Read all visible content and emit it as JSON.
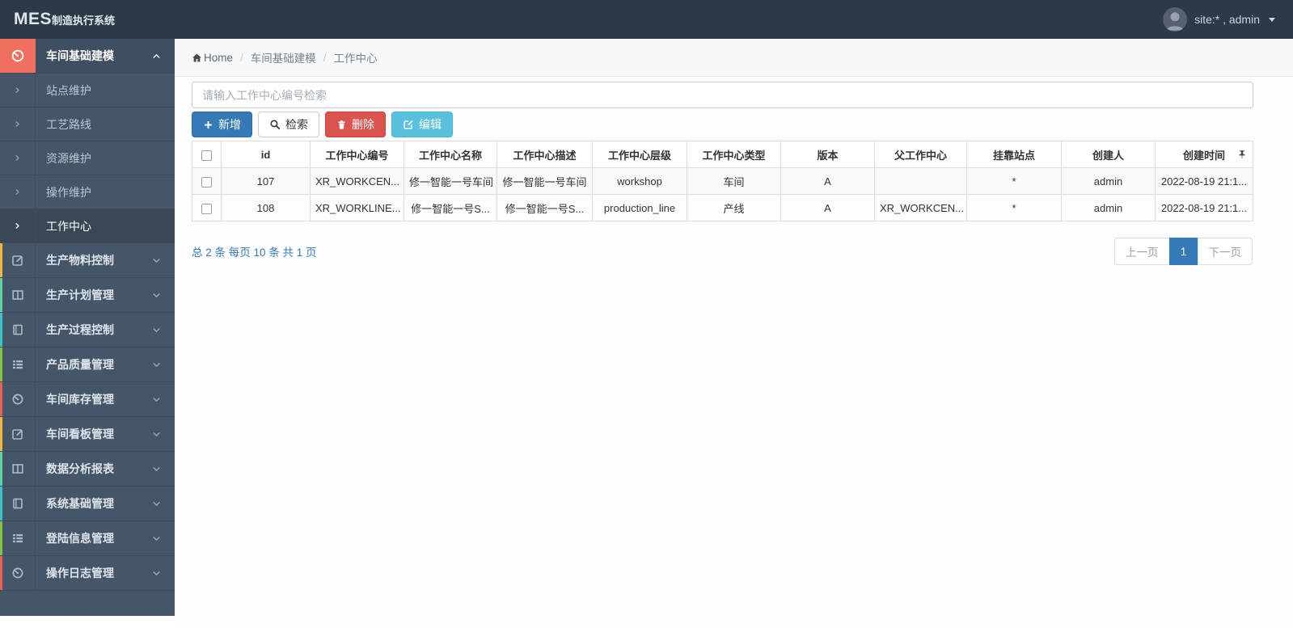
{
  "topbar": {
    "logo_main": "MES",
    "logo_sub": "制造执行系统",
    "user_label": "site:* , admin"
  },
  "breadcrumb": {
    "home": "Home",
    "section": "车间基础建模",
    "page": "工作中心"
  },
  "sidebar": {
    "active_parent": {
      "label": "车间基础建模",
      "icon": "gauge-icon",
      "icon_bg": "#ef705f"
    },
    "submenu": [
      {
        "label": "站点维护"
      },
      {
        "label": "工艺路线"
      },
      {
        "label": "资源维护"
      },
      {
        "label": "操作维护"
      },
      {
        "label": "工作中心"
      }
    ],
    "items": [
      {
        "label": "生产物料控制",
        "icon": "edit-icon",
        "strip_color": "#f5b63f"
      },
      {
        "label": "生产计划管理",
        "icon": "columns-icon",
        "strip_color": "#62d2a2"
      },
      {
        "label": "生产过程控制",
        "icon": "book-icon",
        "strip_color": "#3bc4c7"
      },
      {
        "label": "产品质量管理",
        "icon": "list-icon",
        "strip_color": "#85c440"
      },
      {
        "label": "车间库存管理",
        "icon": "gauge-icon",
        "strip_color": "#ea6153"
      },
      {
        "label": "车间看板管理",
        "icon": "edit-icon",
        "strip_color": "#f5b63f"
      },
      {
        "label": "数据分析报表",
        "icon": "columns-icon",
        "strip_color": "#62d2a2"
      },
      {
        "label": "系统基础管理",
        "icon": "book-icon",
        "strip_color": "#3bc4c7"
      },
      {
        "label": "登陆信息管理",
        "icon": "list-icon",
        "strip_color": "#85c440"
      },
      {
        "label": "操作日志管理",
        "icon": "gauge-icon",
        "strip_color": "#ea6153"
      }
    ]
  },
  "toolbar": {
    "search_placeholder": "请输入工作中心编号检索",
    "add_label": "新增",
    "search_label": "检索",
    "delete_label": "删除",
    "edit_label": "编辑"
  },
  "table": {
    "columns": [
      "id",
      "工作中心编号",
      "工作中心名称",
      "工作中心描述",
      "工作中心层级",
      "工作中心类型",
      "版本",
      "父工作中心",
      "挂靠站点",
      "创建人",
      "创建时间"
    ],
    "rows": [
      [
        "107",
        "XR_WORKCEN...",
        "修一智能一号车间",
        "修一智能一号车间",
        "workshop",
        "车间",
        "A",
        "",
        "*",
        "admin",
        "2022-08-19 21:1..."
      ],
      [
        "108",
        "XR_WORKLINE...",
        "修一智能一号S...",
        "修一智能一号S...",
        "production_line",
        "产线",
        "A",
        "XR_WORKCEN...",
        "*",
        "admin",
        "2022-08-19 21:1..."
      ]
    ]
  },
  "pagination": {
    "summary": "总 2 条 每页 10 条 共 1 页",
    "prev_label": "上一页",
    "current_page": "1",
    "next_label": "下一页"
  },
  "colors": {
    "accent_blue": "#337ab7",
    "danger_red": "#d9534f",
    "info_blue": "#5bc0de",
    "topbar_bg": "#2c3949",
    "sidebar_bg": "#465669"
  }
}
